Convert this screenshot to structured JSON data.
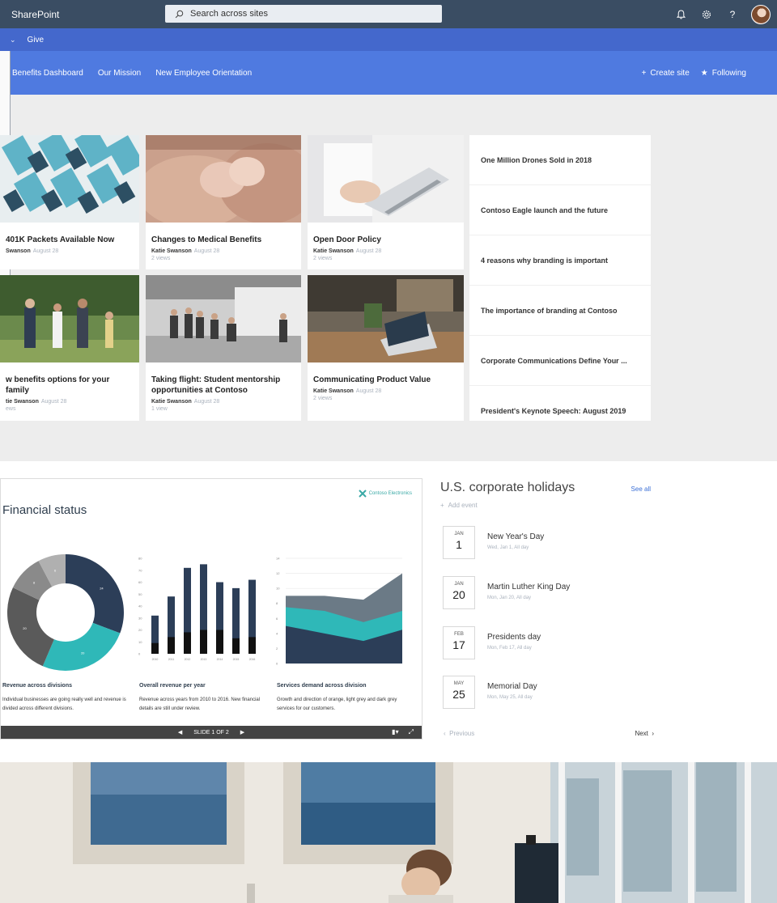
{
  "suitebar": {
    "app_name": "SharePoint",
    "search_placeholder": "Search across sites"
  },
  "hubbar": {
    "items": [
      "Give"
    ]
  },
  "site_nav": {
    "links": [
      "Benefits Dashboard",
      "Our Mission",
      "New Employee Orientation"
    ],
    "create_site": "Create site",
    "following": "Following"
  },
  "news_cards": [
    {
      "title": "401K Packets Available Now",
      "author": "Swanson",
      "date": "August 28",
      "views": ""
    },
    {
      "title": "Changes to Medical Benefits",
      "author": "Katie Swanson",
      "date": "August 28",
      "views": "2 views"
    },
    {
      "title": "Open Door Policy",
      "author": "Katie Swanson",
      "date": "August 28",
      "views": "2 views"
    },
    {
      "title": "w benefits options for your family",
      "author": "tie Swanson",
      "date": "August 28",
      "views": "ews"
    },
    {
      "title": "Taking flight: Student mentorship opportunities at Contoso",
      "author": "Katie Swanson",
      "date": "August 28",
      "views": "1 view"
    },
    {
      "title": "Communicating Product Value",
      "author": "Katie Swanson",
      "date": "August 28",
      "views": "2 views"
    }
  ],
  "news_list": [
    "One Million Drones Sold in 2018",
    "Contoso Eagle launch and the future",
    "4 reasons why branding is important",
    "The importance of branding at Contoso",
    "Corporate Communications Define Your ...",
    "President's Keynote Speech: August 2019"
  ],
  "slide": {
    "title": "Financial status",
    "logo_text": "Contoso Electronics",
    "pager_text": "SLIDE 1 OF 2",
    "columns": [
      {
        "heading": "Revenue across divisions",
        "desc": "Individual businesses are going really well and revenue is divided across different divisions."
      },
      {
        "heading": "Overall revenue per year",
        "desc": "Revenue across years from 2010 to 2016. New financial details are still under review."
      },
      {
        "heading": "Services demand across division",
        "desc": "Growth and direction of orange, light grey and dark grey services for our customers."
      }
    ]
  },
  "chart_data": [
    {
      "type": "pie",
      "title": "Revenue across divisions",
      "slices": [
        {
          "label": "24",
          "value": 24,
          "color": "#2c3e58"
        },
        {
          "label": "20",
          "value": 20,
          "color": "#2fb8b8"
        },
        {
          "label": "20",
          "value": 20,
          "color": "#5a5a5a"
        },
        {
          "label": "8",
          "value": 8,
          "color": "#8a8a8a"
        },
        {
          "label": "6",
          "value": 6,
          "color": "#b0b0b0"
        }
      ]
    },
    {
      "type": "bar",
      "title": "Overall revenue per year",
      "categories": [
        "2010",
        "2011",
        "2012",
        "2013",
        "2014",
        "2015",
        "2016"
      ],
      "series": [
        {
          "values": [
            32,
            48,
            72,
            75,
            60,
            55,
            62
          ],
          "color": "#2c3e58"
        },
        {
          "values": [
            9,
            14,
            18,
            20,
            20,
            13,
            14
          ],
          "color": "#111111"
        }
      ],
      "ylim": [
        0,
        80
      ],
      "yticks": [
        0,
        10,
        20,
        30,
        40,
        50,
        60,
        70,
        80
      ]
    },
    {
      "type": "area",
      "title": "Services demand across division",
      "x": [
        0,
        1,
        2,
        3
      ],
      "series": [
        {
          "values": [
            9,
            9,
            8.5,
            12
          ],
          "color": "#6b7a86"
        },
        {
          "values": [
            7.5,
            7,
            5.5,
            7
          ],
          "color": "#2fb8b8"
        },
        {
          "values": [
            5,
            4,
            3,
            4.5
          ],
          "color": "#2c3e58"
        }
      ],
      "ylim": [
        0,
        14
      ],
      "yticks": [
        0,
        2,
        4,
        6,
        8,
        10,
        12,
        14
      ]
    }
  ],
  "holidays": {
    "heading": "U.S. corporate holidays",
    "see_all": "See all",
    "add_event": "Add event",
    "events": [
      {
        "month": "JAN",
        "day": "1",
        "name": "New Year's Day",
        "when": "Wed, Jan 1, All day"
      },
      {
        "month": "JAN",
        "day": "20",
        "name": "Martin Luther King Day",
        "when": "Mon, Jan 20, All day"
      },
      {
        "month": "FEB",
        "day": "17",
        "name": "Presidents day",
        "when": "Mon, Feb 17, All day"
      },
      {
        "month": "MAY",
        "day": "25",
        "name": "Memorial Day",
        "when": "Mon, May 25, All day"
      }
    ],
    "prev": "Previous",
    "next": "Next"
  },
  "colors": {
    "suitebar": "#3a4d63",
    "hubbar": "#4468cc",
    "siteheader": "#4f7ae0",
    "accent": "#3b6fd6",
    "teal": "#2fb8b8",
    "navy": "#2c3e58"
  }
}
